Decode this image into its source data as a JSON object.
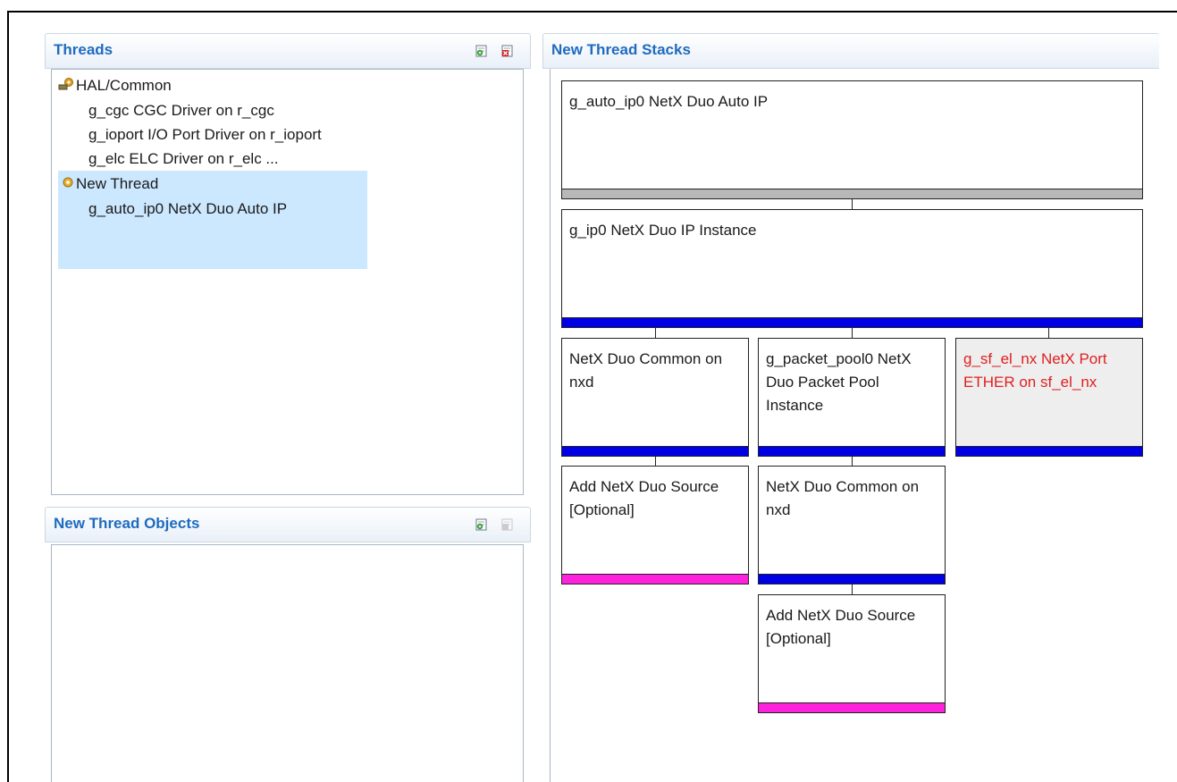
{
  "colors": {
    "accent_title": "#1f6bbf",
    "selection": "#cce8ff",
    "bar_gray": "#b8b8b8",
    "bar_blue": "#0000e6",
    "bar_magenta": "#ff22dd",
    "error_text": "#e02020",
    "error_bg": "#eeeeee"
  },
  "threads_panel": {
    "title": "Threads",
    "add_icon": "add-thread-icon",
    "remove_icon": "remove-thread-icon",
    "items": [
      {
        "label": "HAL/Common",
        "icon": "hal-gear-icon"
      },
      {
        "label": "g_cgc CGC Driver on r_cgc"
      },
      {
        "label": "g_ioport I/O Port Driver on r_ioport"
      },
      {
        "label": "g_elc ELC Driver on r_elc ..."
      },
      {
        "label": "New Thread",
        "icon": "thread-gear-icon"
      },
      {
        "label": "g_auto_ip0 NetX Duo Auto IP"
      }
    ]
  },
  "objects_panel": {
    "title": "New Thread Objects",
    "add_icon": "add-object-icon",
    "remove_icon": "remove-object-icon"
  },
  "stacks_panel": {
    "title": "New Thread Stacks",
    "boxes": [
      {
        "label": "g_auto_ip0 NetX Duo Auto IP"
      },
      {
        "label": "g_ip0 NetX Duo IP Instance"
      },
      {
        "label": "NetX Duo Common on nxd"
      },
      {
        "label": "g_packet_pool0 NetX Duo Packet Pool Instance"
      },
      {
        "label": "g_sf_el_nx NetX Port ETHER on sf_el_nx"
      },
      {
        "label": "Add NetX Duo Source [Optional]"
      },
      {
        "label": "NetX Duo Common on nxd"
      },
      {
        "label": "Add NetX Duo Source [Optional]"
      }
    ]
  }
}
